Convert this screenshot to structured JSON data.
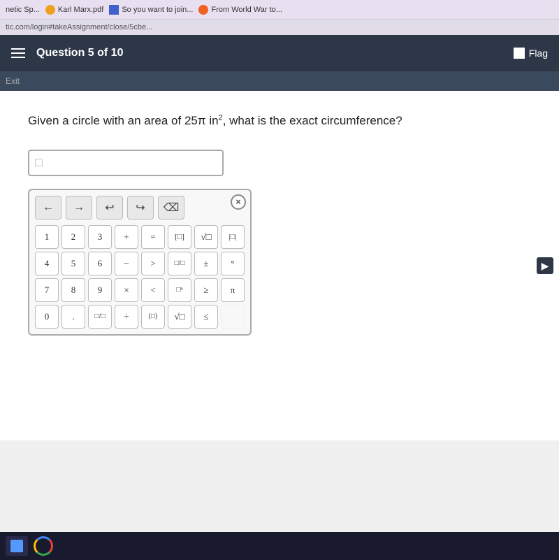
{
  "browser": {
    "url_partial": "tic.com/login#takeAssignment/close/5cbe...",
    "tabs": [
      {
        "label": "netic Sp..."
      },
      {
        "label": "Karl Marx.pdf",
        "icon": "pdf"
      },
      {
        "label": "So you want to join...",
        "icon": "table"
      },
      {
        "label": "From World War to..."
      }
    ]
  },
  "quiz_header": {
    "question_label": "Question 5 of 10",
    "flag_label": "Flag"
  },
  "exit_label": "Exit",
  "question": {
    "text_before": "Given a circle with an area of 25",
    "pi_symbol": "π",
    "text_middle": " in",
    "superscript": "2",
    "text_after": ", what is the exact circumference?"
  },
  "answer_input": {
    "placeholder": "□"
  },
  "keyboard": {
    "nav_buttons": [
      "←",
      "→",
      "↩",
      "↪"
    ],
    "clear": "⌫",
    "close": "×",
    "rows": [
      [
        "1",
        "2",
        "3",
        "+",
        "=",
        "[□]",
        "√□",
        "‌|□|"
      ],
      [
        "4",
        "5",
        "6",
        "−",
        ">",
        "□□",
        "±",
        "°"
      ],
      [
        "7",
        "8",
        "9",
        "×",
        "<",
        "□ⁿ",
        "≥",
        "π"
      ],
      [
        "0",
        ".",
        "□/□",
        "÷",
        "(□)",
        "√□",
        "≤",
        ""
      ]
    ]
  },
  "right_arrow": "▶"
}
